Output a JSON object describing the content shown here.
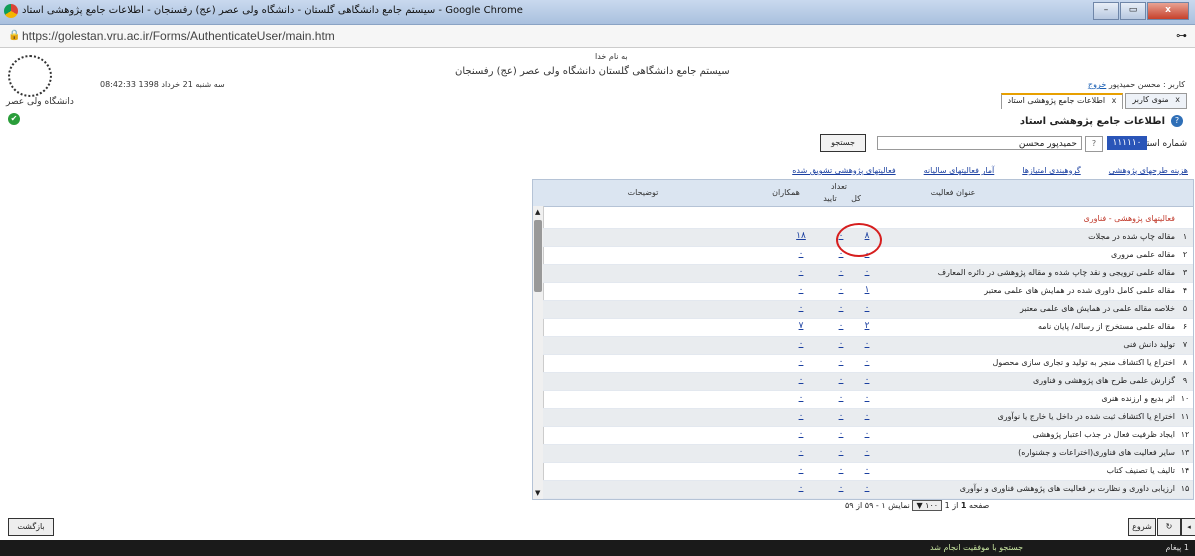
{
  "window": {
    "title": "سیستم جامع دانشگاهی گلستان - دانشگاه ولی عصر (عج) رفسنجان - اطلاعات جامع پژوهشی استاد - Google Chrome",
    "min": "–",
    "max": "▭",
    "close": "x"
  },
  "browser": {
    "url": "https://golestan.vru.ac.ir/Forms/AuthenticateUser/main.htm",
    "lock": "🔒",
    "key": "⊶"
  },
  "header": {
    "bismillah": "به نام خدا",
    "system_name": "سیستم جامع دانشگاهی گلستان   دانشگاه ولی عصر (عج) رفسنجان",
    "datetime": "08:42:33 سه شنبه 21 خرداد 1398",
    "logo_caption": "دانشگاه ولی عصر",
    "user_text": "کاربر : محسن حمیدپور",
    "exit_label": "خروج",
    "ok_icon": "✔"
  },
  "tabs": [
    {
      "label": "منوی کاربر",
      "close": "x"
    },
    {
      "label": "اطلاعات جامع پژوهشی استاد",
      "close": "x"
    }
  ],
  "page": {
    "heading": "اطلاعات جامع پژوهشی استاد",
    "help": "?",
    "ident_label": "شماره استاد",
    "ident_number": "۱۱۱۱۱۰",
    "ident_q": "?",
    "ident_name": "حمیدپور محسن",
    "search_button": "جستجو"
  },
  "links": [
    "هزینه طرحهای پژوهشی",
    "گروهبندی امتیازها",
    "آمار فعالیتهای سالیانه",
    "فعالیتهای پژوهشی تشویق شده"
  ],
  "table": {
    "headers": {
      "title": "عنوان فعالیت",
      "count": "تعداد",
      "total": "کل",
      "approved": "تایید",
      "colleagues": "همکاران",
      "notes": "توضیحات"
    },
    "category": "فعالیتهای پژوهشی - فناوری",
    "rows": [
      {
        "idx": "۱",
        "title": "مقاله چاپ شده در مجلات",
        "total": "۸",
        "approved": "۰",
        "colleagues": "۱۸"
      },
      {
        "idx": "۲",
        "title": "مقاله علمی مروری",
        "total": "۰",
        "approved": "۰",
        "colleagues": "۰"
      },
      {
        "idx": "۳",
        "title": "مقاله علمی ترویجی و نقد چاپ شده و مقاله پژوهشی در دائره المعارف",
        "total": "۰",
        "approved": "۰",
        "colleagues": "۰"
      },
      {
        "idx": "۴",
        "title": "مقاله علمی کامل داوری شده در همایش های علمی معتبر",
        "total": "۱",
        "approved": "۰",
        "colleagues": "۰"
      },
      {
        "idx": "۵",
        "title": "خلاصه مقاله علمی در همایش های علمی معتبر",
        "total": "۰",
        "approved": "۰",
        "colleagues": "۰"
      },
      {
        "idx": "۶",
        "title": "مقاله علمی مستخرج از رساله/ پایان نامه",
        "total": "۲",
        "approved": "۰",
        "colleagues": "۷"
      },
      {
        "idx": "۷",
        "title": "تولید دانش فنی",
        "total": "۰",
        "approved": "۰",
        "colleagues": "۰"
      },
      {
        "idx": "۸",
        "title": "اختراع یا اکتشاف منجر به تولید و تجاری سازی محصول",
        "total": "۰",
        "approved": "۰",
        "colleagues": "۰"
      },
      {
        "idx": "۹",
        "title": "گزارش علمی طرح های پژوهشی و فناوری",
        "total": "۰",
        "approved": "۰",
        "colleagues": "۰"
      },
      {
        "idx": "۱۰",
        "title": "اثر بدیع و ارزنده هنری",
        "total": "۰",
        "approved": "۰",
        "colleagues": "۰"
      },
      {
        "idx": "۱۱",
        "title": "اختراع یا اکتشاف ثبت شده در داخل یا خارج یا نوآوری",
        "total": "۰",
        "approved": "۰",
        "colleagues": "۰"
      },
      {
        "idx": "۱۲",
        "title": "ایجاد ظرفیت فعال در جذب اعتبار پژوهشی",
        "total": "۰",
        "approved": "۰",
        "colleagues": "۰"
      },
      {
        "idx": "۱۳",
        "title": "سایر فعالیت های فناوری(اختراعات و جشنواره)",
        "total": "۰",
        "approved": "۰",
        "colleagues": "۰"
      },
      {
        "idx": "۱۴",
        "title": "تالیف یا تصنیف کتاب",
        "total": "۰",
        "approved": "۰",
        "colleagues": "۰"
      },
      {
        "idx": "۱۵",
        "title": "ارزیابی داوری و نظارت بر فعالیت های پژوهشی فناوری و نوآوری",
        "total": "۰",
        "approved": "۰",
        "colleagues": "۰"
      }
    ]
  },
  "pager": {
    "page_label": "صفحه",
    "page_num": "1",
    "of_label": "از 1",
    "page_size": "۱۰۰ ▼",
    "display": "نمایش ۱ - ۵۹ از ۵۹"
  },
  "footer": {
    "back_button": "بازگشت",
    "refresh": "↻",
    "update": "شروع",
    "right_btn": "◂",
    "status_message": "جستجو با موفقیت انجام شد",
    "message_count": "1 پیغام"
  }
}
